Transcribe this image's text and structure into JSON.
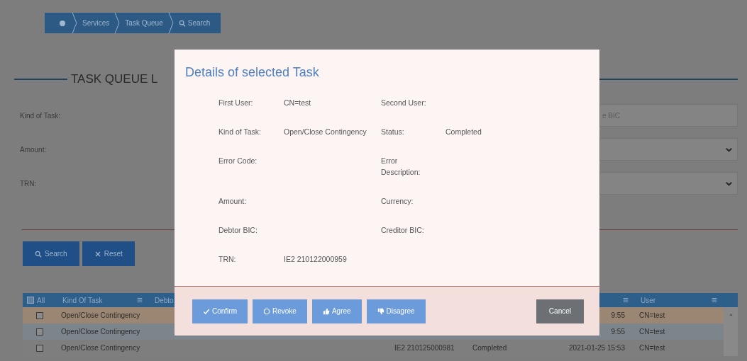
{
  "breadcrumb": [
    {
      "kind": "home"
    },
    {
      "kind": "text",
      "label": "Services"
    },
    {
      "kind": "text",
      "label": "Task Queue"
    },
    {
      "kind": "search",
      "label": "Search"
    }
  ],
  "page_title": "TASK QUEUE L",
  "filters": [
    {
      "kind": "text",
      "label": "Kind of Task:",
      "placeholder": "e BIC"
    },
    {
      "kind": "select",
      "label": "Amount:"
    },
    {
      "kind": "select",
      "label": "TRN:"
    }
  ],
  "actions": [
    {
      "kind": "search",
      "label": "Search"
    },
    {
      "kind": "reset",
      "label": "Reset"
    }
  ],
  "table": {
    "select_all": {
      "label": "All",
      "checked": false
    },
    "columns": [
      {
        "label": "Kind Of Task",
        "menu": true
      },
      {
        "label": "Debto"
      },
      {},
      {},
      {
        "menu": true
      },
      {
        "label": "User",
        "menu": true
      }
    ],
    "rows": [
      {
        "selected": true,
        "checked": false,
        "cells": [
          "Open/Close Contingency",
          null,
          null,
          null,
          "9:55",
          "CN=test"
        ]
      },
      {
        "selected": false,
        "checked": false,
        "cells": [
          "Open/Close Contingency",
          null,
          null,
          null,
          "9:55",
          "CN=test"
        ]
      },
      {
        "selected": false,
        "checked": false,
        "cells": [
          "Open/Close Contingency",
          null,
          "IE2 210125000981",
          "Completed",
          "2021-01-25 15:53",
          "CN=test"
        ]
      }
    ]
  },
  "modal": {
    "title": "Details of selected Task",
    "fields": [
      {
        "label": "First User:",
        "value": "CN=test"
      },
      {
        "label": "Second User:"
      },
      {
        "label": "Kind of Task:",
        "value": "Open/Close Contingency"
      },
      {
        "label": "Status:",
        "value": "Completed"
      },
      {
        "label": "Error Code:"
      },
      {
        "label": "Error Description:"
      },
      {
        "label": "Amount:"
      },
      {
        "label": "Currency:"
      },
      {
        "label": "Debtor BIC:"
      },
      {
        "label": "Creditor BIC:"
      },
      {
        "label": "TRN:",
        "value": "IE2 210122000959"
      }
    ],
    "buttons": [
      {
        "kind": "primary",
        "label": "Confirm"
      },
      {
        "kind": "primary",
        "label": "Revoke"
      },
      {
        "kind": "primary",
        "label": "Agree"
      },
      {
        "kind": "primary",
        "label": "Disagree"
      },
      {
        "kind": "secondary",
        "label": "Cancel"
      }
    ]
  }
}
